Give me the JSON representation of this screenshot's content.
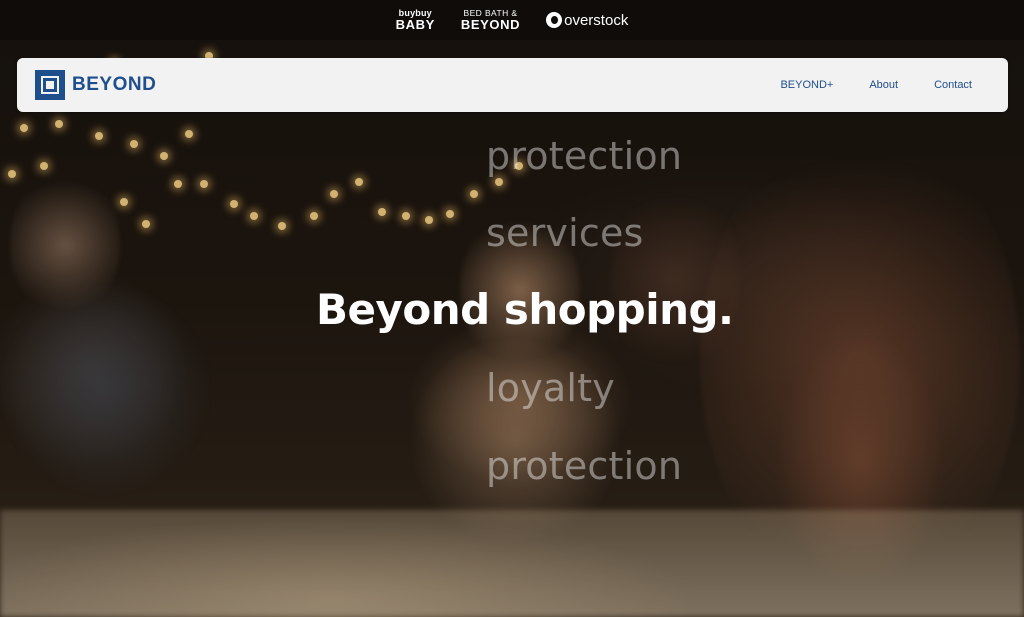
{
  "brand_strip": {
    "buybuy_baby": {
      "top": "buybuy",
      "bottom": "BABY"
    },
    "bed_bath_beyond": {
      "top": "BED BATH &",
      "bottom": "BEYOND"
    },
    "overstock": {
      "label": "overstock"
    }
  },
  "nav": {
    "logo_text": "BEYOND",
    "links": [
      "BEYOND+",
      "About",
      "Contact"
    ]
  },
  "hero": {
    "headline": "Beyond shopping.",
    "rotating_words": [
      "protection",
      "services",
      "loyalty",
      "protection"
    ]
  },
  "colors": {
    "brand_blue": "#1f4e8c",
    "nav_background": "#f2f2f2",
    "strip_background": "#0f0c0a"
  }
}
